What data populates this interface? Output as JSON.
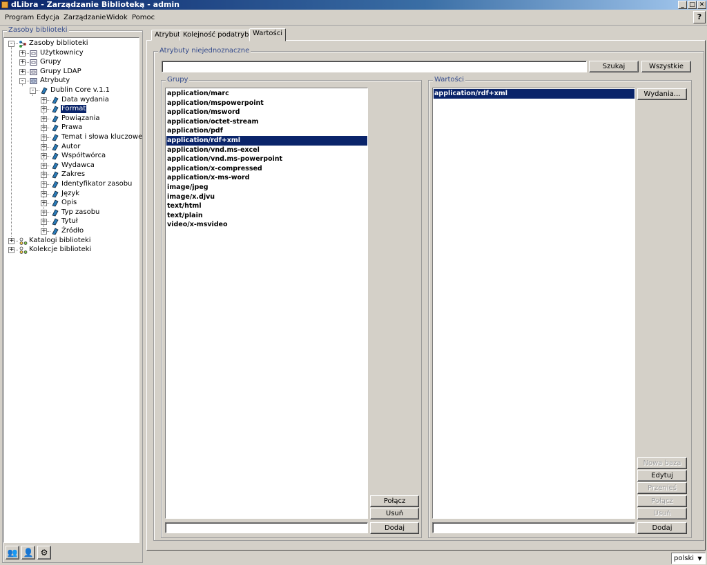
{
  "window": {
    "title": "dLibra - Zarządzanie Biblioteką - admin"
  },
  "menu": [
    "Program",
    "Edycja",
    "Zarządzanie",
    "Widok",
    "Pomoc"
  ],
  "left_panel": {
    "title": "Zasoby biblioteki",
    "tree": [
      {
        "label": "Zasoby biblioteki",
        "level": 0,
        "toggle": "-",
        "icon": "resources-icon"
      },
      {
        "label": "Użytkownicy",
        "level": 1,
        "toggle": "+",
        "icon": "folder-icon"
      },
      {
        "label": "Grupy",
        "level": 1,
        "toggle": "+",
        "icon": "folder-icon"
      },
      {
        "label": "Grupy LDAP",
        "level": 1,
        "toggle": "+",
        "icon": "folder-icon"
      },
      {
        "label": "Atrybuty",
        "level": 1,
        "toggle": "-",
        "icon": "folder-open-icon"
      },
      {
        "label": "Dublin Core v.1.1",
        "level": 2,
        "toggle": "-",
        "icon": "attribute-icon"
      },
      {
        "label": "Data wydania",
        "level": 3,
        "toggle": "+",
        "icon": "attribute-icon"
      },
      {
        "label": "Format",
        "level": 3,
        "toggle": "+",
        "icon": "attribute-icon",
        "selected": true
      },
      {
        "label": "Powiązania",
        "level": 3,
        "toggle": "+",
        "icon": "attribute-icon"
      },
      {
        "label": "Prawa",
        "level": 3,
        "toggle": "+",
        "icon": "attribute-icon"
      },
      {
        "label": "Temat i słowa kluczowe",
        "level": 3,
        "toggle": "+",
        "icon": "attribute-icon"
      },
      {
        "label": "Autor",
        "level": 3,
        "toggle": "+",
        "icon": "attribute-icon"
      },
      {
        "label": "Współtwórca",
        "level": 3,
        "toggle": "+",
        "icon": "attribute-icon"
      },
      {
        "label": "Wydawca",
        "level": 3,
        "toggle": "+",
        "icon": "attribute-icon"
      },
      {
        "label": "Zakres",
        "level": 3,
        "toggle": "+",
        "icon": "attribute-icon"
      },
      {
        "label": "Identyfikator zasobu",
        "level": 3,
        "toggle": "+",
        "icon": "attribute-icon"
      },
      {
        "label": "Język",
        "level": 3,
        "toggle": "+",
        "icon": "attribute-icon"
      },
      {
        "label": "Opis",
        "level": 3,
        "toggle": "+",
        "icon": "attribute-icon"
      },
      {
        "label": "Typ zasobu",
        "level": 3,
        "toggle": "+",
        "icon": "attribute-icon"
      },
      {
        "label": "Tytuł",
        "level": 3,
        "toggle": "+",
        "icon": "attribute-icon"
      },
      {
        "label": "Źródło",
        "level": 3,
        "toggle": "+",
        "icon": "attribute-icon"
      },
      {
        "label": "Katalogi biblioteki",
        "level": 0,
        "toggle": "+",
        "icon": "catalog-icon"
      },
      {
        "label": "Kolekcje biblioteki",
        "level": 0,
        "toggle": "+",
        "icon": "catalog-icon"
      }
    ],
    "bottom_icons": [
      "users-icon",
      "user-icon",
      "tools-icon"
    ]
  },
  "tabs": [
    {
      "label": "Atrybut",
      "active": false
    },
    {
      "label": "Kolejność podatrybutów",
      "active": false
    },
    {
      "label": "Wartości",
      "active": true
    }
  ],
  "ambiguous": {
    "title": "Atrybuty niejednoznaczne",
    "search_value": "",
    "search_button": "Szukaj",
    "all_button": "Wszystkie"
  },
  "groups": {
    "title": "Grupy",
    "items": [
      "application/marc",
      "application/mspowerpoint",
      "application/msword",
      "application/octet-stream",
      "application/pdf",
      "application/rdf+xml",
      "application/vnd.ms-excel",
      "application/vnd.ms-powerpoint",
      "application/x-compressed",
      "application/x-ms-word",
      "image/jpeg",
      "image/x.djvu",
      "text/html",
      "text/plain",
      "video/x-msvideo"
    ],
    "selected_index": 5,
    "connect_button": "Połącz",
    "remove_button": "Usuń",
    "add_button": "Dodaj",
    "new_value": ""
  },
  "values": {
    "title": "Wartości",
    "items": [
      "application/rdf+xml"
    ],
    "selected_index": 0,
    "editions_button": "Wydania...",
    "new_base_button": "Nowa baza",
    "edit_button": "Edytuj",
    "move_button": "Przenieś",
    "connect_button": "Połącz",
    "remove_button": "Usuń",
    "add_button": "Dodaj",
    "new_value": ""
  },
  "status": {
    "language": "polski"
  }
}
